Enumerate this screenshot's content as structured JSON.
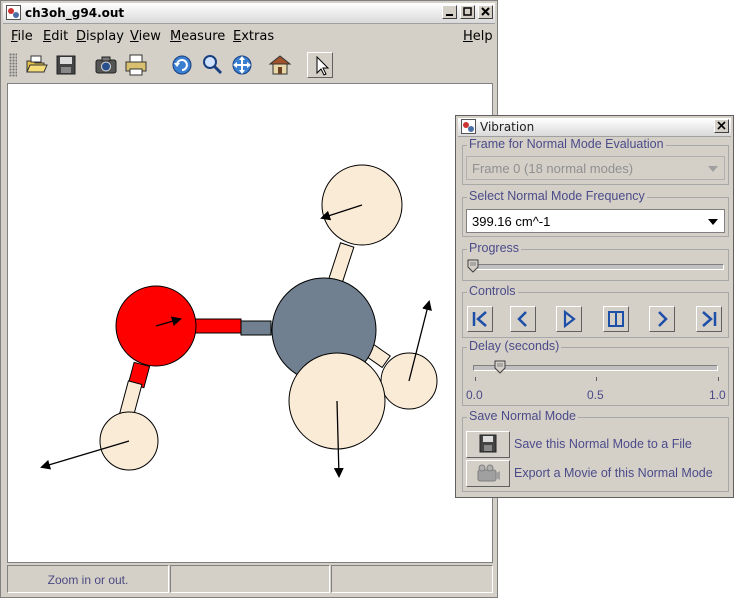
{
  "main_window": {
    "title": "ch3oh_g94.out",
    "menus": [
      "File",
      "Edit",
      "Display",
      "View",
      "Measure",
      "Extras",
      "Help"
    ],
    "toolbar": [
      "open-icon",
      "save-icon",
      "camera-icon",
      "print-icon",
      "rotate-icon",
      "zoom-icon",
      "translate-icon",
      "home-icon",
      "pointer-icon"
    ],
    "status": [
      "Zoom in or out.",
      "",
      ""
    ]
  },
  "vibration": {
    "title": "Vibration",
    "frame_group": {
      "label": "Frame for Normal Mode Evaluation",
      "value": "Frame 0 (18 normal modes)"
    },
    "freq_group": {
      "label": "Select Normal Mode Frequency",
      "value": "399.16 cm^-1"
    },
    "progress_group": {
      "label": "Progress",
      "value": 0
    },
    "controls_group": {
      "label": "Controls"
    },
    "delay_group": {
      "label": "Delay (seconds)",
      "min": "0.0",
      "mid": "0.5",
      "max": "1.0",
      "value": 0.1
    },
    "save_group": {
      "label": "Save Normal Mode",
      "save_file": "Save this Normal Mode to a File",
      "export_movie": "Export a Movie of this Normal Mode"
    }
  },
  "colors": {
    "oxygen": "#ff0000",
    "carbon": "#708090",
    "hydrogen": "#faebd7"
  }
}
